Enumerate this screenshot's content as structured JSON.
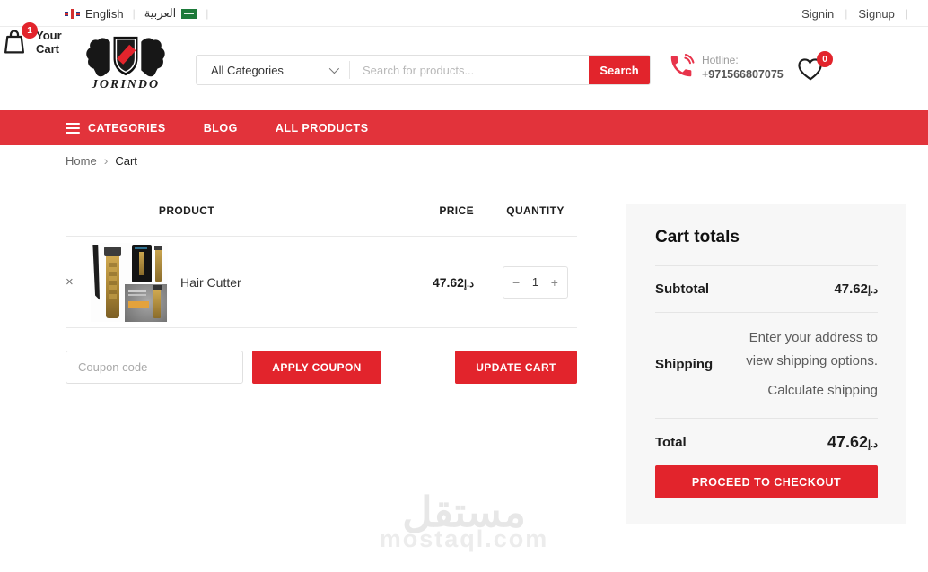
{
  "topbar": {
    "languages": [
      {
        "label": "English",
        "flag": "uk-flag"
      },
      {
        "label": "العربية",
        "flag": "saudi-flag"
      }
    ],
    "signin": "Signin",
    "signup": "Signup"
  },
  "header": {
    "brand": "JORINDO",
    "search": {
      "category": "All Categories",
      "placeholder": "Search for products...",
      "button": "Search"
    },
    "hotline": {
      "label": "Hotline:",
      "number": "+971566807075"
    },
    "wishlist_count": "0",
    "cart_count": "1",
    "cart_label_line1": "Your",
    "cart_label_line2": "Cart"
  },
  "nav": {
    "items": [
      "CATEGORIES",
      "BLOG",
      "ALL PRODUCTS"
    ]
  },
  "breadcrumb": {
    "home": "Home",
    "sep": "›",
    "current": "Cart"
  },
  "cart_table": {
    "headers": {
      "product": "PRODUCT",
      "price": "PRICE",
      "quantity": "QUANTITY"
    },
    "controls": {
      "remove": "×",
      "minus": "−",
      "plus": "+"
    },
    "rows": [
      {
        "name": "Hair Cutter",
        "price": "47.62",
        "currency": "د.إ",
        "quantity": "1"
      }
    ]
  },
  "coupon": {
    "placeholder": "Coupon code",
    "apply_label": "APPLY COUPON",
    "update_label": "UPDATE CART"
  },
  "totals": {
    "title": "Cart totals",
    "subtotal_label": "Subtotal",
    "subtotal": "47.62",
    "currency": "د.إ",
    "shipping_label": "Shipping",
    "shipping_note_line1": "Enter your address to",
    "shipping_note_line2": "view shipping options.",
    "calculate_label": "Calculate shipping",
    "total_label": "Total",
    "total": "47.62",
    "checkout_label": "PROCEED TO CHECKOUT"
  },
  "watermark": {
    "arabic": "مستقل",
    "domain": "mostaql.com"
  },
  "colors": {
    "accent": "#e2242c",
    "nav_bg": "#e2333b",
    "sidebar_bg": "#f7f7f7"
  }
}
